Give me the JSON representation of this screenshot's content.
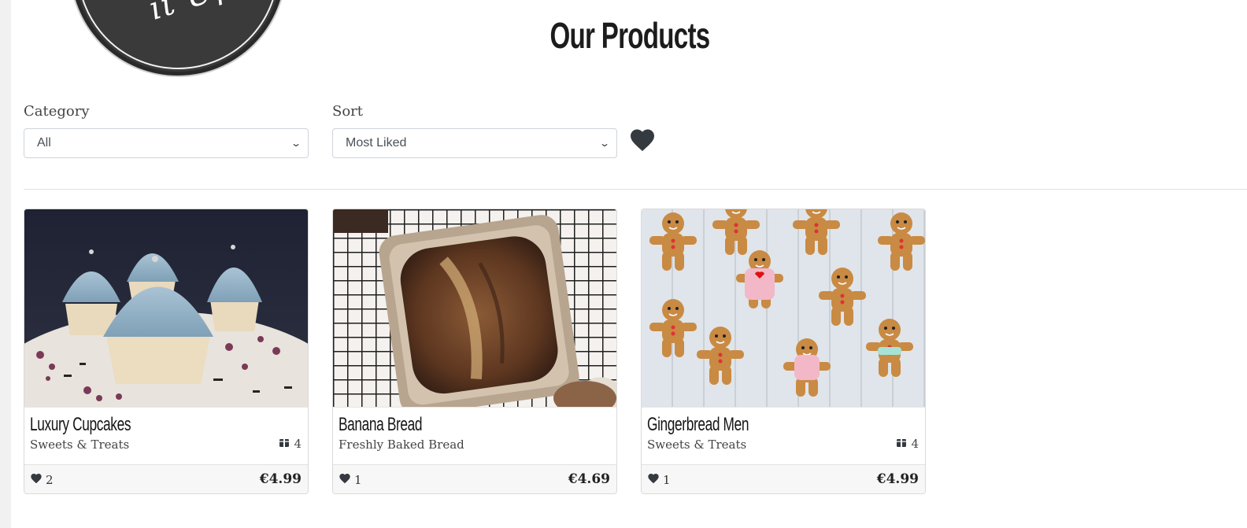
{
  "brand": {
    "logo_text": "it Up!"
  },
  "page": {
    "title": "Our Products"
  },
  "filters": {
    "category": {
      "label": "Category",
      "value": "All"
    },
    "sort": {
      "label": "Sort",
      "value": "Most Liked"
    },
    "favorites_icon": "heart-icon"
  },
  "products": [
    {
      "name": "Luxury Cupcakes",
      "category": "Sweets & Treats",
      "stock": "4",
      "likes": "2",
      "price": "€4.99",
      "image": "cupcakes-photo"
    },
    {
      "name": "Banana Bread",
      "category": "Freshly Baked Bread",
      "stock": "",
      "likes": "1",
      "price": "€4.69",
      "image": "banana-bread-photo"
    },
    {
      "name": "Gingerbread Men",
      "category": "Sweets & Treats",
      "stock": "4",
      "likes": "1",
      "price": "€4.99",
      "image": "gingerbread-photo"
    }
  ],
  "colors": {
    "icon_dark": "#343a40",
    "card_border": "#dadada"
  }
}
